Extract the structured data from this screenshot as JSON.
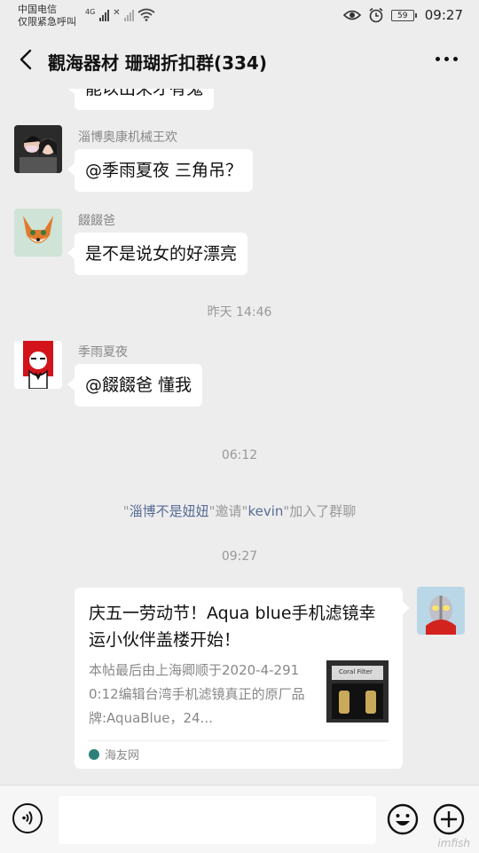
{
  "status_bar": {
    "carrier_line1": "中国电信",
    "carrier_line2": "仅限紧急呼叫",
    "network": "4G",
    "battery": "59",
    "time": "09:27"
  },
  "header": {
    "title": "觀海器材 珊瑚折扣群(334)"
  },
  "messages": [
    {
      "text": "能以出来才有鬼"
    },
    {
      "sender": "淄博奥康机械王欢",
      "text": "@季雨夏夜  三角吊？"
    },
    {
      "sender": "餟餟爸",
      "text": "是不是说女的好漂亮"
    },
    {
      "sender": "季雨夏夜",
      "text": "@餟餟爸  懂我"
    }
  ],
  "timestamps": [
    "昨天 14:46",
    "06:12",
    "09:27"
  ],
  "system_message": {
    "q1": "\"",
    "inviter": "淄博不是妞妞",
    "mid": "\"邀请\"",
    "invitee": "kevin",
    "end": "\"加入了群聊"
  },
  "link_card": {
    "title": "庆五一劳动节！Aqua blue手机滤镜幸运小伙伴盖楼开始！",
    "description": "本帖最后由上海卿顺于2020-4-2910:12编辑台湾手机滤镜真正的原厂品牌:AquaBlue，24...",
    "thumbnail_label": "Coral Filter",
    "source": "海友网"
  },
  "watermark": "imfish"
}
